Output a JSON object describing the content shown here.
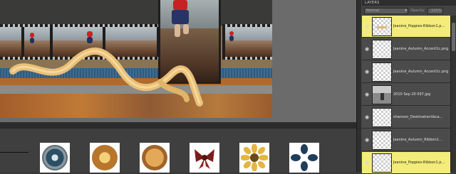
{
  "layers_panel": {
    "title": "LAYERS",
    "blend_mode": "Normal",
    "opacity_label": "Opacity:",
    "opacity_value": "100%",
    "layers": [
      {
        "name": "Jeanine_Poppies-Ribbon1.p...",
        "selected": true,
        "thumb": "ribbon-icon"
      },
      {
        "name": "Jeanine_Autumn_Accent1c.png",
        "selected": false,
        "thumb": "transparent"
      },
      {
        "name": "Jeanine_Autumn_Accent1c.png",
        "selected": false,
        "thumb": "transparent"
      },
      {
        "name": "2010 Sep 20 097.jpg",
        "selected": false,
        "thumb": "photo"
      },
      {
        "name": "shannon_DestinationVaca...",
        "selected": false,
        "thumb": "transparent"
      },
      {
        "name": "Jeanine_Autumn_Ribbon1...",
        "selected": false,
        "thumb": "transparent"
      },
      {
        "name": "Jeanine_Poppies-Ribbon1.p...",
        "selected": true,
        "thumb": "transparent"
      }
    ]
  },
  "project_bin": {
    "items": [
      {
        "name": "blue-flower-badge-icon"
      },
      {
        "name": "gold-flower-badge-icon"
      },
      {
        "name": "bronze-badge-icon"
      },
      {
        "name": "red-bow-icon"
      },
      {
        "name": "yellow-flower-icon"
      },
      {
        "name": "blue-flower-icon"
      }
    ]
  },
  "colors": {
    "selection": "#f4ec7a",
    "panel": "#4a4a4a",
    "bin": "#3f3f3f"
  }
}
